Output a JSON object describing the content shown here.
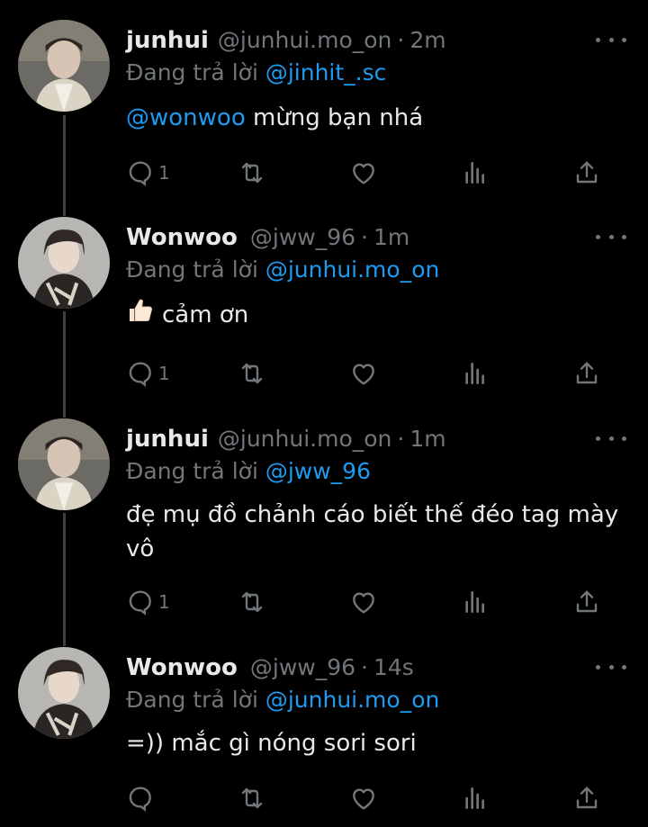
{
  "tweets": [
    {
      "name": "junhui",
      "handle": "@junhui.mo_on",
      "time": "2m",
      "reply_prefix": "Đang trả lời ",
      "reply_to": "@jinhit_.sc",
      "mention": "@wonwoo",
      "text": " mừng bạn nhá",
      "reply_count": "1"
    },
    {
      "name": "Wonwoo",
      "handle": "@jww_96",
      "time": "1m",
      "reply_prefix": "Đang trả lời ",
      "reply_to": "@junhui.mo_on",
      "emoji": "thumbs-up",
      "text": "cảm ơn",
      "reply_count": "1"
    },
    {
      "name": "junhui",
      "handle": "@junhui.mo_on",
      "time": "1m",
      "reply_prefix": "Đang trả lời ",
      "reply_to": "@jww_96",
      "text_line1": "đẹ mụ đồ chảnh cáo biết thế đéo tag mày",
      "text_line2": "vô",
      "reply_count": "1"
    },
    {
      "name": "Wonwoo",
      "handle": "@jww_96",
      "time": "14s",
      "reply_prefix": "Đang trả lời ",
      "reply_to": "@junhui.mo_on",
      "text": "=)) mắc gì nóng sori sori",
      "reply_count": ""
    }
  ],
  "separator": "·",
  "colors": {
    "accent": "#1d9bf0",
    "muted": "#71767b",
    "text": "#e7e9ea",
    "background": "#000000"
  },
  "icons": [
    "reply-icon",
    "retweet-icon",
    "like-icon",
    "views-icon",
    "share-icon",
    "more-icon"
  ]
}
